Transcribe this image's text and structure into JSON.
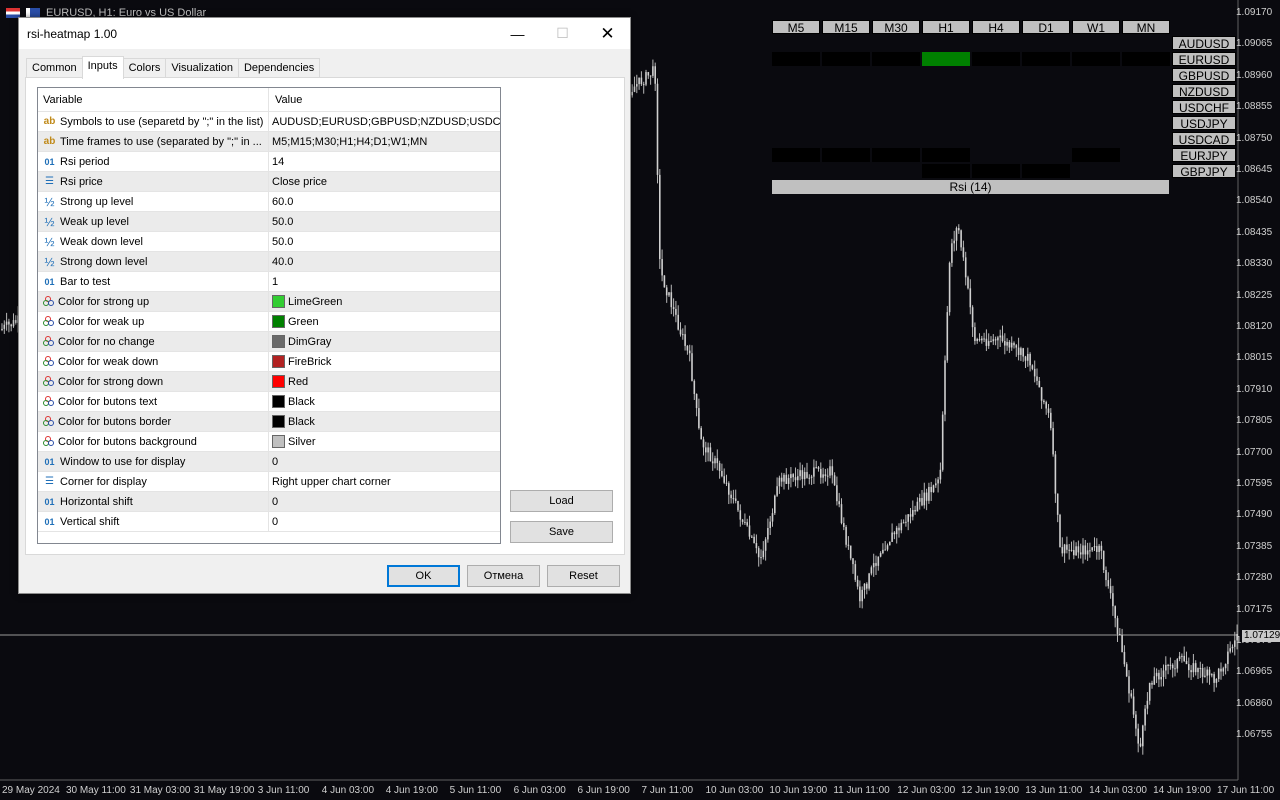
{
  "chart": {
    "title": "EURUSD, H1:  Euro vs US Dollar",
    "current_price": "1.07129",
    "price_labels": [
      "1.09170",
      "1.09065",
      "1.08960",
      "1.08855",
      "1.08750",
      "1.08645",
      "1.08540",
      "1.08435",
      "1.08330",
      "1.08225",
      "1.08120",
      "1.08015",
      "1.07910",
      "1.07805",
      "1.07700",
      "1.07595",
      "1.07490",
      "1.07385",
      "1.07280",
      "1.07175",
      "1.07070",
      "1.06965",
      "1.06860",
      "1.06755"
    ],
    "time_labels": [
      "29 May 2024",
      "30 May 11:00",
      "31 May 03:00",
      "31 May 19:00",
      "3 Jun 11:00",
      "4 Jun 03:00",
      "4 Jun 19:00",
      "5 Jun 11:00",
      "6 Jun 03:00",
      "6 Jun 19:00",
      "7 Jun 11:00",
      "10 Jun 03:00",
      "10 Jun 19:00",
      "11 Jun 11:00",
      "12 Jun 03:00",
      "12 Jun 19:00",
      "13 Jun 11:00",
      "14 Jun 03:00",
      "14 Jun 19:00",
      "17 Jun 11:00"
    ]
  },
  "heatmap": {
    "timeframes": [
      "M5",
      "M15",
      "M30",
      "H1",
      "H4",
      "D1",
      "W1",
      "MN"
    ],
    "symbols": [
      "AUDUSD",
      "EURUSD",
      "GBPUSD",
      "NZDUSD",
      "USDCHF",
      "USDJPY",
      "USDCAD",
      "EURJPY",
      "GBPJPY"
    ],
    "footer": "Rsi (14)",
    "colors": {
      "strong_up": "#32cd32",
      "weak_up": "#008000",
      "no_change": "#000000",
      "button_bg": "#c0c0c0"
    }
  },
  "dialog": {
    "title": "rsi-heatmap 1.00",
    "tabs": [
      "Common",
      "Inputs",
      "Colors",
      "Visualization",
      "Dependencies"
    ],
    "active_tab": "Inputs",
    "columns": {
      "variable": "Variable",
      "value": "Value"
    },
    "params": [
      {
        "icon": "ab",
        "name": "Symbols to use (separetd by \";\" in the list)",
        "value": "AUDUSD;EURUSD;GBPUSD;NZDUSD;USDCH..."
      },
      {
        "icon": "ab",
        "name": "Time frames to use (separated by \";\" in ...",
        "value": "M5;M15;M30;H1;H4;D1;W1;MN"
      },
      {
        "icon": "01",
        "name": "Rsi period",
        "value": "14"
      },
      {
        "icon": "enum",
        "name": "Rsi price",
        "value": "Close price"
      },
      {
        "icon": "half",
        "name": "Strong up level",
        "value": "60.0"
      },
      {
        "icon": "half",
        "name": "Weak up level",
        "value": "50.0"
      },
      {
        "icon": "half",
        "name": "Weak down level",
        "value": "50.0"
      },
      {
        "icon": "half",
        "name": "Strong down level",
        "value": "40.0"
      },
      {
        "icon": "01",
        "name": "Bar to test",
        "value": "1"
      },
      {
        "icon": "color",
        "name": "Color for strong up",
        "value": "LimeGreen",
        "swatch": "#32cd32"
      },
      {
        "icon": "color",
        "name": "Color for weak up",
        "value": "Green",
        "swatch": "#008000"
      },
      {
        "icon": "color",
        "name": "Color for no change",
        "value": "DimGray",
        "swatch": "#696969"
      },
      {
        "icon": "color",
        "name": "Color for weak down",
        "value": "FireBrick",
        "swatch": "#b22222"
      },
      {
        "icon": "color",
        "name": "Color for strong down",
        "value": "Red",
        "swatch": "#ff0000"
      },
      {
        "icon": "color",
        "name": "Color for butons text",
        "value": "Black",
        "swatch": "#000000"
      },
      {
        "icon": "color",
        "name": "Color for butons border",
        "value": "Black",
        "swatch": "#000000"
      },
      {
        "icon": "color",
        "name": "Color for butons background",
        "value": "Silver",
        "swatch": "#c0c0c0"
      },
      {
        "icon": "01",
        "name": "Window to use for display",
        "value": "0"
      },
      {
        "icon": "enum",
        "name": "Corner for display",
        "value": "Right upper chart corner"
      },
      {
        "icon": "01",
        "name": "Horizontal shift",
        "value": "0"
      },
      {
        "icon": "01",
        "name": "Vertical shift",
        "value": "0"
      }
    ],
    "buttons": {
      "load": "Load",
      "save": "Save",
      "ok": "OK",
      "cancel": "Отмена",
      "reset": "Reset"
    }
  }
}
